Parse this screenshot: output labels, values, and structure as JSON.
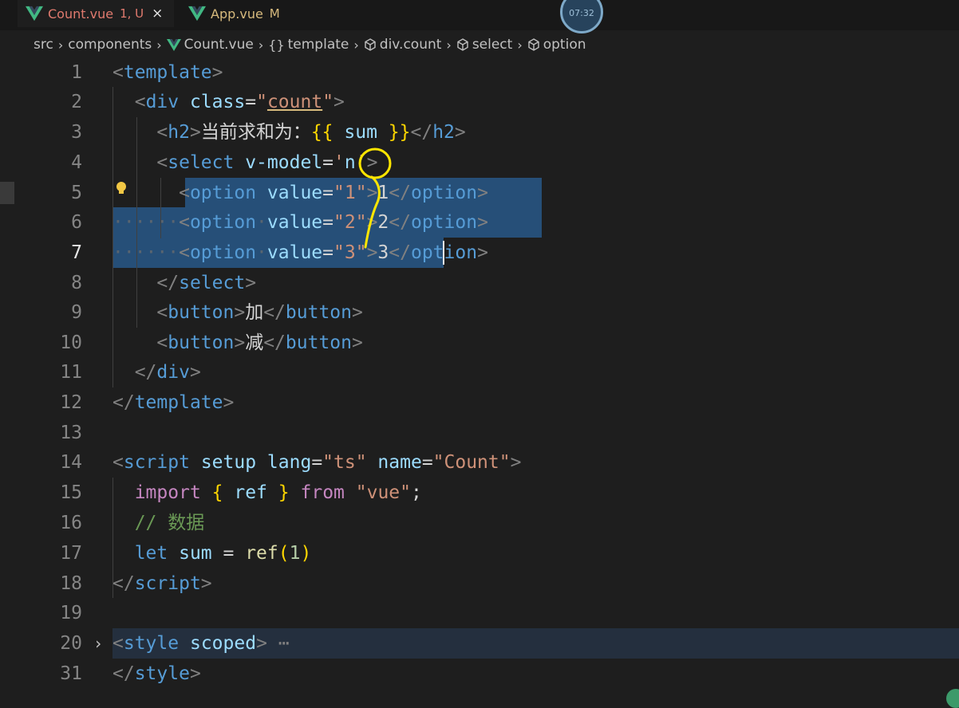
{
  "tabs": [
    {
      "name": "Count.vue",
      "flag": "1, U",
      "close": "×",
      "active": true
    },
    {
      "name": "App.vue",
      "flag": "M",
      "active": false
    }
  ],
  "recording_time": "07:32",
  "breadcrumb": [
    "src",
    "components",
    "Count.vue",
    "template",
    "div.count",
    "select",
    "option"
  ],
  "breadcrumb_sep": "›",
  "lines": [
    {
      "n": "1",
      "tokens": [
        [
          "br",
          "<"
        ],
        [
          "tg",
          "template"
        ],
        [
          "br",
          ">"
        ]
      ]
    },
    {
      "n": "2",
      "tokens": [
        [
          "ws",
          "  "
        ],
        [
          "br",
          "<"
        ],
        [
          "tg",
          "div"
        ],
        [
          "tx",
          " "
        ],
        [
          "at",
          "class"
        ],
        [
          "tx",
          "="
        ],
        [
          "st",
          "\""
        ],
        [
          "st",
          "count"
        ],
        [
          "st",
          "\""
        ],
        [
          "br",
          ">"
        ]
      ]
    },
    {
      "n": "3",
      "tokens": [
        [
          "ws",
          "    "
        ],
        [
          "br",
          "<"
        ],
        [
          "tg",
          "h2"
        ],
        [
          "br",
          ">"
        ],
        [
          "tx",
          "当前求和为："
        ],
        [
          "yb",
          "{{"
        ],
        [
          "tx",
          " "
        ],
        [
          "va",
          "sum"
        ],
        [
          "tx",
          " "
        ],
        [
          "yb",
          "}}"
        ],
        [
          "br",
          "</"
        ],
        [
          "tg",
          "h2"
        ],
        [
          "br",
          ">"
        ]
      ]
    },
    {
      "n": "4",
      "tokens": [
        [
          "ws",
          "    "
        ],
        [
          "br",
          "<"
        ],
        [
          "tg",
          "select"
        ],
        [
          "tx",
          " "
        ],
        [
          "at",
          "v-model"
        ],
        [
          "tx",
          "="
        ],
        [
          "st",
          "'"
        ],
        [
          "va",
          "n"
        ],
        [
          "st",
          "'"
        ],
        [
          "br",
          ">"
        ]
      ]
    },
    {
      "n": "5",
      "tokens": [
        [
          "ws",
          "      "
        ],
        [
          "br",
          "<"
        ],
        [
          "tg",
          "option"
        ],
        [
          "tx",
          " "
        ],
        [
          "at",
          "value"
        ],
        [
          "tx",
          "="
        ],
        [
          "st",
          "\"1\""
        ],
        [
          "br",
          ">"
        ],
        [
          "tx",
          "1"
        ],
        [
          "br",
          "</"
        ],
        [
          "tg",
          "option"
        ],
        [
          "br",
          ">"
        ]
      ]
    },
    {
      "n": "6",
      "tokens": [
        [
          "ws",
          "······"
        ],
        [
          "br",
          "<"
        ],
        [
          "tg",
          "option"
        ],
        [
          "ws",
          "·"
        ],
        [
          "at",
          "value"
        ],
        [
          "tx",
          "="
        ],
        [
          "st",
          "\"2\""
        ],
        [
          "br",
          ">"
        ],
        [
          "tx",
          "2"
        ],
        [
          "br",
          "</"
        ],
        [
          "tg",
          "option"
        ],
        [
          "br",
          ">"
        ]
      ]
    },
    {
      "n": "7",
      "tokens": [
        [
          "ws",
          "······"
        ],
        [
          "br",
          "<"
        ],
        [
          "tg",
          "option"
        ],
        [
          "ws",
          "·"
        ],
        [
          "at",
          "value"
        ],
        [
          "tx",
          "="
        ],
        [
          "st",
          "\"3\""
        ],
        [
          "br",
          ">"
        ],
        [
          "tx",
          "3"
        ],
        [
          "br",
          "</"
        ],
        [
          "tg",
          "option"
        ],
        [
          "br",
          ">"
        ]
      ]
    },
    {
      "n": "8",
      "tokens": [
        [
          "ws",
          "    "
        ],
        [
          "br",
          "</"
        ],
        [
          "tg",
          "select"
        ],
        [
          "br",
          ">"
        ]
      ]
    },
    {
      "n": "9",
      "tokens": [
        [
          "ws",
          "    "
        ],
        [
          "br",
          "<"
        ],
        [
          "tg",
          "button"
        ],
        [
          "br",
          ">"
        ],
        [
          "tx",
          "加"
        ],
        [
          "br",
          "</"
        ],
        [
          "tg",
          "button"
        ],
        [
          "br",
          ">"
        ]
      ]
    },
    {
      "n": "10",
      "tokens": [
        [
          "ws",
          "    "
        ],
        [
          "br",
          "<"
        ],
        [
          "tg",
          "button"
        ],
        [
          "br",
          ">"
        ],
        [
          "tx",
          "减"
        ],
        [
          "br",
          "</"
        ],
        [
          "tg",
          "button"
        ],
        [
          "br",
          ">"
        ]
      ]
    },
    {
      "n": "11",
      "tokens": [
        [
          "ws",
          "  "
        ],
        [
          "br",
          "</"
        ],
        [
          "tg",
          "div"
        ],
        [
          "br",
          ">"
        ]
      ]
    },
    {
      "n": "12",
      "tokens": [
        [
          "br",
          "</"
        ],
        [
          "tg",
          "template"
        ],
        [
          "br",
          ">"
        ]
      ]
    },
    {
      "n": "13",
      "tokens": []
    },
    {
      "n": "14",
      "tokens": [
        [
          "br",
          "<"
        ],
        [
          "tg",
          "script"
        ],
        [
          "tx",
          " "
        ],
        [
          "at",
          "setup"
        ],
        [
          "tx",
          " "
        ],
        [
          "at",
          "lang"
        ],
        [
          "tx",
          "="
        ],
        [
          "st",
          "\"ts\""
        ],
        [
          "tx",
          " "
        ],
        [
          "at",
          "name"
        ],
        [
          "tx",
          "="
        ],
        [
          "st",
          "\"Count\""
        ],
        [
          "br",
          ">"
        ]
      ]
    },
    {
      "n": "15",
      "tokens": [
        [
          "ws",
          "  "
        ],
        [
          "kw",
          "import"
        ],
        [
          "tx",
          " "
        ],
        [
          "yb",
          "{"
        ],
        [
          "tx",
          " "
        ],
        [
          "va",
          "ref"
        ],
        [
          "tx",
          " "
        ],
        [
          "yb",
          "}"
        ],
        [
          "tx",
          " "
        ],
        [
          "kw",
          "from"
        ],
        [
          "tx",
          " "
        ],
        [
          "st",
          "\"vue\""
        ],
        [
          "tx",
          ";"
        ]
      ]
    },
    {
      "n": "16",
      "tokens": [
        [
          "ws",
          "  "
        ],
        [
          "cm",
          "// 数据"
        ]
      ]
    },
    {
      "n": "17",
      "tokens": [
        [
          "ws",
          "  "
        ],
        [
          "k2",
          "let"
        ],
        [
          "tx",
          " "
        ],
        [
          "va",
          "sum"
        ],
        [
          "tx",
          " = "
        ],
        [
          "fn",
          "ref"
        ],
        [
          "yb",
          "("
        ],
        [
          "nm",
          "1"
        ],
        [
          "yb",
          ")"
        ]
      ]
    },
    {
      "n": "18",
      "tokens": [
        [
          "br",
          "</"
        ],
        [
          "tg",
          "script"
        ],
        [
          "br",
          ">"
        ]
      ]
    },
    {
      "n": "19",
      "tokens": []
    },
    {
      "n": "20",
      "tokens": [
        [
          "br",
          "<"
        ],
        [
          "tg",
          "style"
        ],
        [
          "tx",
          " "
        ],
        [
          "at",
          "scoped"
        ],
        [
          "br",
          ">"
        ],
        [
          "br",
          " ⋯"
        ]
      ]
    },
    {
      "n": "31",
      "tokens": [
        [
          "br",
          "</"
        ],
        [
          "tg",
          "style"
        ],
        [
          "br",
          ">"
        ]
      ]
    }
  ],
  "colors": {
    "tag": "#569cd6",
    "attr": "#9cdcfe",
    "string": "#ce9178",
    "keyword": "#c586c0",
    "comment": "#6a9955",
    "selection": "#264f78",
    "annotation": "#ffe600"
  }
}
